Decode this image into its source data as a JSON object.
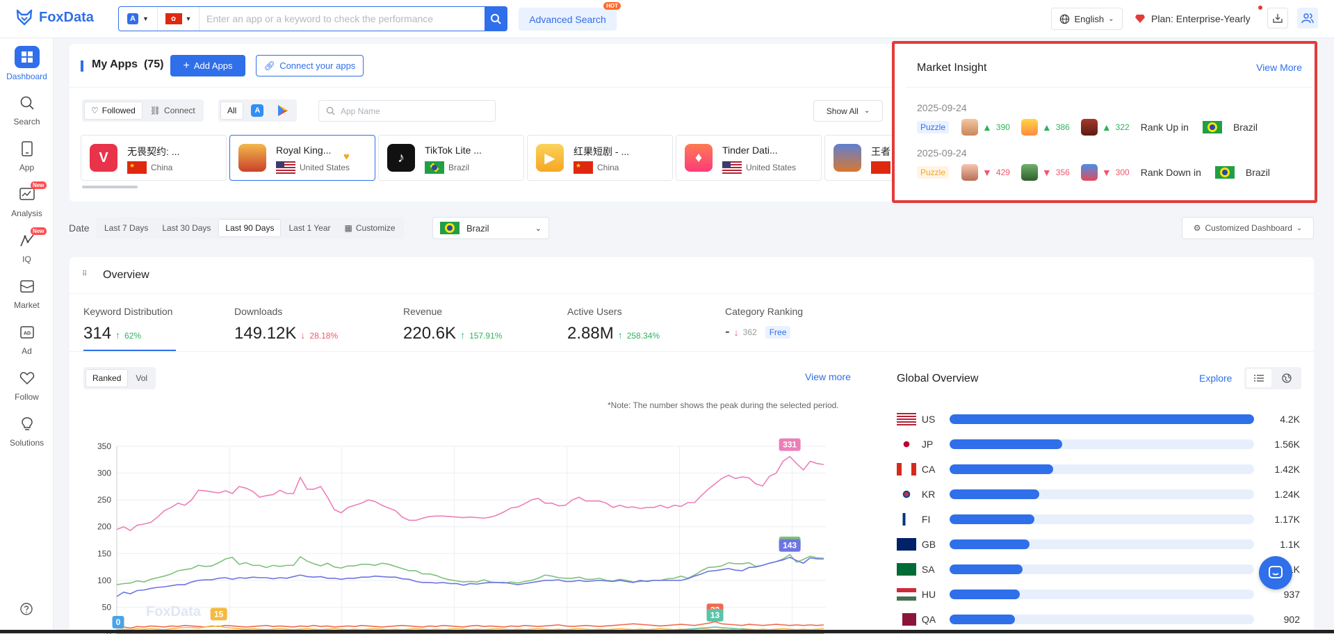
{
  "brand": {
    "name": "FoxData"
  },
  "topbar": {
    "search_placeholder": "Enter an app or a keyword to check the performance",
    "advanced_search": "Advanced Search",
    "hot": "HOT",
    "language": "English",
    "plan": "Plan: Enterprise-Yearly"
  },
  "sidebar": {
    "items": [
      {
        "label": "Dashboard",
        "icon": "dashboard-icon"
      },
      {
        "label": "Search",
        "icon": "search-icon"
      },
      {
        "label": "App",
        "icon": "app-icon"
      },
      {
        "label": "Analysis",
        "icon": "analysis-icon",
        "badge": "New"
      },
      {
        "label": "IQ",
        "icon": "iq-icon",
        "badge": "New"
      },
      {
        "label": "Market",
        "icon": "market-icon"
      },
      {
        "label": "Ad",
        "icon": "ad-icon"
      },
      {
        "label": "Follow",
        "icon": "heart-icon"
      },
      {
        "label": "Solutions",
        "icon": "lightbulb-icon"
      }
    ]
  },
  "myapps": {
    "title": "My Apps",
    "count": "(75)",
    "add_apps": "Add Apps",
    "connect_apps": "Connect your apps",
    "filter_followed": "Followed",
    "filter_connect": "Connect",
    "platform_all": "All",
    "search_placeholder": "App Name",
    "show_all": "Show All",
    "apps": [
      {
        "name": "无畏契约: ...",
        "country": "China",
        "color": "#e8334a"
      },
      {
        "name": "Royal King...",
        "country": "United States",
        "color": "#c9412a"
      },
      {
        "name": "TikTok Lite ...",
        "country": "Brazil",
        "color": "#111111"
      },
      {
        "name": "红果短剧 - ...",
        "country": "China",
        "color": "#f6a623"
      },
      {
        "name": "Tinder Dati...",
        "country": "United States",
        "color": "#fd4f6c"
      },
      {
        "name": "王者",
        "country": "",
        "color": "#d9782f"
      }
    ]
  },
  "insight": {
    "title": "Market Insight",
    "view_more": "View More",
    "rows": [
      {
        "date": "2025-09-24",
        "tag": "Puzzle",
        "direction": "up",
        "values": [
          "390",
          "386",
          "322"
        ],
        "label": "Rank Up in",
        "country": "Brazil"
      },
      {
        "date": "2025-09-24",
        "tag": "Puzzle",
        "direction": "down",
        "values": [
          "429",
          "356",
          "300"
        ],
        "label": "Rank Down in",
        "country": "Brazil"
      }
    ]
  },
  "datebar": {
    "label": "Date",
    "options": [
      "Last 7 Days",
      "Last 30 Days",
      "Last 90 Days",
      "Last 1 Year",
      "Customize"
    ],
    "selected": "Last 90 Days",
    "country": "Brazil",
    "customized_dashboard": "Customized Dashboard"
  },
  "overview": {
    "title": "Overview",
    "metrics": [
      {
        "label": "Keyword Distribution",
        "value": "314",
        "change": "62%",
        "dir": "up"
      },
      {
        "label": "Downloads",
        "value": "149.12K",
        "change": "28.18%",
        "dir": "down"
      },
      {
        "label": "Revenue",
        "value": "220.6K",
        "change": "157.91%",
        "dir": "up"
      },
      {
        "label": "Active Users",
        "value": "2.88M",
        "change": "258.34%",
        "dir": "up"
      },
      {
        "label": "Category Ranking",
        "value": "-",
        "change": "362",
        "dir": "down",
        "badge": "Free"
      }
    ],
    "chart_tabs": [
      "Ranked",
      "Vol"
    ],
    "view_more": "View more",
    "note": "*Note: The number shows the peak during the selected period.",
    "watermark": "FoxData"
  },
  "chart_data": {
    "type": "line",
    "y_ticks": [
      "350",
      "300",
      "250",
      "200",
      "150",
      "100",
      "50",
      "0"
    ],
    "ylim": [
      0,
      350
    ],
    "series": [
      {
        "color": "#ec7fb8",
        "peak_label": "331",
        "values": [
          195,
          200,
          193,
          203,
          205,
          208,
          218,
          230,
          236,
          244,
          240,
          250,
          268,
          267,
          265,
          263,
          267,
          262,
          275,
          272,
          266,
          255,
          258,
          260,
          268,
          262,
          262,
          292,
          270,
          270,
          275,
          255,
          232,
          226,
          236,
          240,
          244,
          250,
          247,
          240,
          235,
          230,
          218,
          212,
          212,
          216,
          219,
          220,
          220,
          219,
          218,
          217,
          218,
          217,
          216,
          218,
          222,
          228,
          235,
          237,
          243,
          250,
          253,
          244,
          244,
          239,
          240,
          250,
          255,
          248,
          248,
          248,
          244,
          236,
          240,
          236,
          237,
          234,
          236,
          236,
          240,
          235,
          240,
          238,
          245,
          245,
          258,
          270,
          280,
          290,
          296,
          290,
          293,
          291,
          280,
          276,
          294,
          300,
          322,
          331,
          318,
          306,
          322,
          318,
          316
        ]
      },
      {
        "color": "#7cc27a",
        "peak_label": "148",
        "values": [
          92,
          94,
          95,
          99,
          97,
          102,
          105,
          108,
          112,
          118,
          120,
          122,
          128,
          126,
          127,
          133,
          140,
          143,
          130,
          133,
          128,
          128,
          124,
          128,
          126,
          128,
          128,
          144,
          136,
          131,
          127,
          132,
          125,
          123,
          127,
          127,
          130,
          130,
          128,
          132,
          130,
          126,
          122,
          118,
          118,
          112,
          112,
          109,
          104,
          101,
          99,
          97,
          98,
          97,
          101,
          97,
          96,
          95,
          97,
          95,
          98,
          100,
          104,
          110,
          108,
          105,
          104,
          104,
          106,
          102,
          102,
          104,
          100,
          99,
          102,
          100,
          97,
          98,
          99,
          100,
          100,
          103,
          104,
          108,
          104,
          110,
          118,
          124,
          125,
          127,
          133,
          131,
          131,
          133,
          126,
          128,
          132,
          135,
          140,
          148,
          134,
          139,
          145,
          142,
          141
        ]
      },
      {
        "color": "#6d74e3",
        "peak_label": "143",
        "values": [
          70,
          78,
          75,
          81,
          82,
          85,
          87,
          88,
          90,
          92,
          92,
          97,
          100,
          101,
          101,
          104,
          105,
          102,
          105,
          104,
          106,
          105,
          105,
          103,
          105,
          104,
          107,
          110,
          107,
          106,
          107,
          104,
          104,
          102,
          104,
          104,
          106,
          106,
          108,
          107,
          106,
          106,
          103,
          102,
          98,
          96,
          96,
          95,
          96,
          94,
          94,
          91,
          94,
          93,
          95,
          96,
          96,
          96,
          94,
          92,
          94,
          96,
          98,
          100,
          100,
          101,
          98,
          98,
          100,
          98,
          99,
          100,
          99,
          98,
          100,
          98,
          96,
          100,
          98,
          100,
          100,
          100,
          100,
          100,
          103,
          108,
          112,
          117,
          118,
          120,
          122,
          119,
          118,
          124,
          125,
          128,
          132,
          135,
          138,
          143,
          137,
          132,
          142,
          140,
          140
        ]
      },
      {
        "color": "#ee6a50",
        "peak_label": "23",
        "values": [
          12,
          13,
          11,
          14,
          13,
          15,
          14,
          13,
          15,
          14,
          16,
          15,
          14,
          13,
          15,
          14,
          16,
          15,
          14,
          13,
          14,
          15,
          16,
          14,
          15,
          14,
          13,
          15,
          14,
          16,
          14,
          15,
          13,
          14,
          15,
          14,
          16,
          15,
          14,
          13,
          14,
          15,
          16,
          15,
          14,
          13,
          15,
          14,
          16,
          15,
          14,
          13,
          15,
          16,
          14,
          15,
          14,
          13,
          15,
          14,
          16,
          15,
          14,
          15,
          16,
          17,
          15,
          14,
          15,
          16,
          15,
          14,
          15,
          16,
          17,
          18,
          19,
          18,
          17,
          16,
          15,
          16,
          17,
          18,
          17,
          16,
          18,
          20,
          23,
          19,
          18,
          17,
          16,
          18,
          17,
          16,
          17,
          18,
          17,
          16,
          17,
          16,
          17,
          16,
          17
        ]
      },
      {
        "color": "#f5b942",
        "peak_label": "15",
        "values": [
          8,
          9,
          8,
          10,
          9,
          10,
          9,
          8,
          10,
          11,
          12,
          12,
          11,
          13,
          14,
          15,
          12,
          11,
          10,
          9,
          10,
          9,
          8,
          9,
          10,
          9,
          8,
          9,
          10,
          9,
          8,
          9,
          10,
          9,
          8,
          9,
          8,
          9,
          10,
          9,
          8,
          9,
          8,
          9,
          10,
          9,
          8,
          9,
          8,
          9,
          10,
          9,
          8,
          9,
          8,
          9,
          10,
          9,
          8,
          9,
          8,
          9,
          10,
          9,
          8,
          9,
          8,
          9,
          10,
          9,
          8,
          9,
          8,
          9,
          10,
          9,
          8,
          9,
          8,
          9,
          10,
          9,
          8,
          9,
          8,
          9,
          10,
          9,
          8,
          9,
          8,
          9,
          10,
          9,
          8,
          9,
          8,
          9,
          10,
          9,
          8,
          9,
          8,
          9,
          10
        ]
      },
      {
        "color": "#5cc3a7",
        "peak_label": "13",
        "values": [
          4,
          5,
          4,
          5,
          4,
          5,
          4,
          5,
          4,
          5,
          4,
          5,
          4,
          5,
          4,
          5,
          4,
          5,
          4,
          5,
          4,
          5,
          4,
          5,
          4,
          5,
          4,
          5,
          4,
          5,
          4,
          5,
          4,
          5,
          4,
          5,
          4,
          5,
          4,
          5,
          4,
          5,
          4,
          5,
          4,
          5,
          4,
          5,
          4,
          5,
          4,
          5,
          4,
          5,
          4,
          5,
          4,
          5,
          4,
          5,
          4,
          5,
          4,
          5,
          4,
          5,
          4,
          5,
          4,
          5,
          4,
          5,
          4,
          5,
          4,
          5,
          4,
          5,
          4,
          5,
          5,
          6,
          7,
          8,
          9,
          10,
          11,
          12,
          13,
          12,
          11,
          10,
          9,
          8,
          7,
          6,
          6,
          6,
          6,
          6,
          6,
          6,
          6,
          6,
          6
        ]
      },
      {
        "color": "#4aa3e8",
        "peak_label": "0",
        "values": [
          0,
          0,
          0,
          0,
          0,
          0,
          0,
          0,
          0,
          0,
          0,
          0,
          0,
          0,
          0,
          0,
          0,
          0,
          0,
          0,
          0,
          0,
          0,
          0,
          0,
          0,
          0,
          0,
          0,
          0,
          0,
          0,
          0,
          0,
          0,
          0,
          0,
          0,
          0,
          0,
          0,
          0,
          0,
          0,
          0,
          0,
          0,
          0,
          0,
          0,
          0,
          0,
          0,
          0,
          0,
          0,
          0,
          0,
          0,
          0,
          0,
          0,
          0,
          0,
          0,
          0,
          0,
          0,
          0,
          0,
          0,
          0,
          0,
          0,
          0,
          0,
          0,
          0,
          0,
          0,
          0,
          0,
          0,
          0,
          0,
          0,
          0,
          0,
          0,
          0,
          0,
          0,
          0,
          0,
          0,
          0,
          0,
          0,
          0,
          0,
          0,
          0,
          0,
          0,
          0
        ]
      }
    ]
  },
  "global_overview": {
    "title": "Global Overview",
    "explore": "Explore",
    "rows": [
      {
        "code": "US",
        "value": "4.2K",
        "ratio": 1.0
      },
      {
        "code": "JP",
        "value": "1.56K",
        "ratio": 0.37
      },
      {
        "code": "CA",
        "value": "1.42K",
        "ratio": 0.34
      },
      {
        "code": "KR",
        "value": "1.24K",
        "ratio": 0.295
      },
      {
        "code": "FI",
        "value": "1.17K",
        "ratio": 0.279
      },
      {
        "code": "GB",
        "value": "1.1K",
        "ratio": 0.262
      },
      {
        "code": "SA",
        "value": "1K",
        "ratio": 0.24
      },
      {
        "code": "HU",
        "value": "937",
        "ratio": 0.23
      },
      {
        "code": "QA",
        "value": "902",
        "ratio": 0.215
      }
    ]
  }
}
